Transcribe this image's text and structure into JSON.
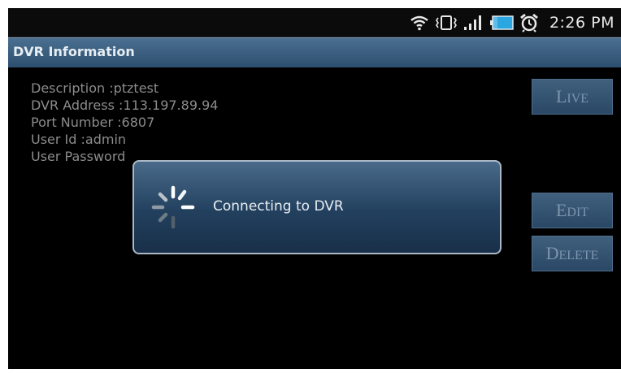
{
  "status": {
    "time": "2:26 PM",
    "icons": [
      "wifi-icon",
      "vibrate-icon",
      "signal-icon",
      "battery-icon",
      "alarm-icon"
    ]
  },
  "title": "DVR Information",
  "info": {
    "description": "Description :ptztest",
    "address": "DVR Address :113.197.89.94",
    "port": "Port Number :6807",
    "user_id": "User Id :admin",
    "user_password": "User Password"
  },
  "buttons": {
    "live_first": "L",
    "live_rest": "IVE",
    "edit_first": "E",
    "edit_rest": "DIT",
    "delete_first": "D",
    "delete_rest": "ELETE"
  },
  "dialog": {
    "message": "Connecting to DVR",
    "icon": "spinner-icon"
  },
  "colors": {
    "titlebar": "#3a5e80",
    "button_bg": "#34536f",
    "button_text": "#7d95ad",
    "dialog_bg": "#2a4866"
  }
}
